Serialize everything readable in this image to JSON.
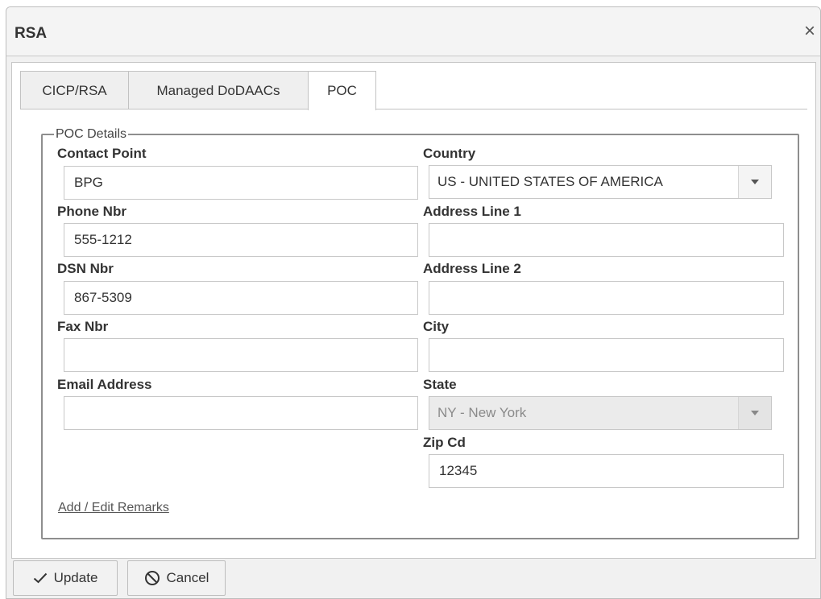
{
  "dialog": {
    "title": "RSA",
    "close_glyph": "×"
  },
  "tabs": [
    {
      "label": "CICP/RSA",
      "active": false
    },
    {
      "label": "Managed DoDAACs",
      "active": false
    },
    {
      "label": "POC",
      "active": true
    }
  ],
  "poc": {
    "legend": "POC Details",
    "contact_point": {
      "label": "Contact Point",
      "value": "BPG"
    },
    "phone_nbr": {
      "label": "Phone Nbr",
      "value": "555-1212"
    },
    "dsn_nbr": {
      "label": "DSN Nbr",
      "value": "867-5309"
    },
    "fax_nbr": {
      "label": "Fax Nbr",
      "value": ""
    },
    "email_address": {
      "label": "Email Address",
      "value": ""
    },
    "country": {
      "label": "Country",
      "value": "US - UNITED STATES OF AMERICA"
    },
    "address_line_1": {
      "label": "Address Line 1",
      "value": ""
    },
    "address_line_2": {
      "label": "Address Line 2",
      "value": ""
    },
    "city": {
      "label": "City",
      "value": ""
    },
    "state": {
      "label": "State",
      "value": "NY - New York",
      "disabled": true
    },
    "zip_cd": {
      "label": "Zip Cd",
      "value": "12345"
    },
    "remarks_link": "Add / Edit Remarks"
  },
  "footer": {
    "update_label": "Update",
    "cancel_label": "Cancel"
  },
  "icons": {
    "close": "close-icon",
    "dropdown": "chevron-down-icon",
    "update": "check-icon",
    "cancel": "cancel-circle-icon"
  }
}
